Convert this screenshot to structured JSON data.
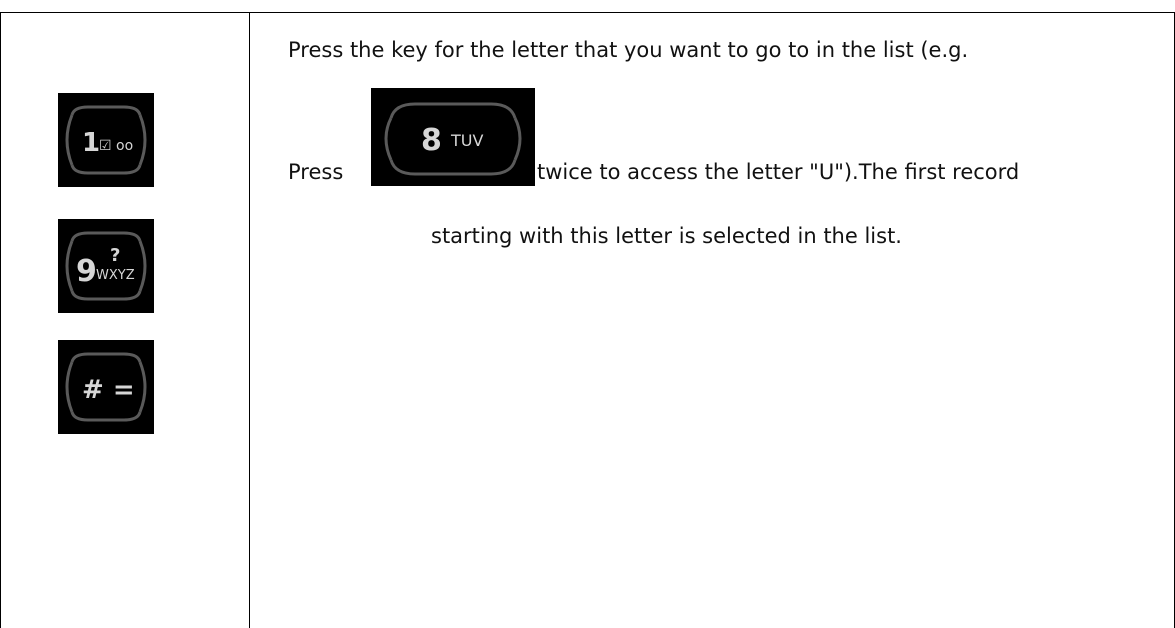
{
  "keys": {
    "key_1": {
      "digit": "1",
      "symbols": "☑ oo",
      "icon": "key-1-voicemail-icon"
    },
    "key_9": {
      "digit": "9",
      "letters": "WXYZ",
      "symbol": "?",
      "icon": "key-9-wxyz-icon"
    },
    "key_hash": {
      "symbols": "# =",
      "icon": "key-hash-icon"
    },
    "key_8": {
      "digit": "8",
      "letters": "TUV",
      "icon": "key-8-tuv-icon"
    }
  },
  "description": {
    "line1": "Press the key for the letter that you want to go to in the list (e.g.",
    "press_word": "Press",
    "line2_rest": "twice to access the letter \"U\").The first record",
    "line3": "starting with this letter is selected in the list."
  },
  "colors": {
    "key_background": "#000000",
    "key_outline": "#5a5a5a",
    "key_glyph": "#d6d6d6"
  }
}
